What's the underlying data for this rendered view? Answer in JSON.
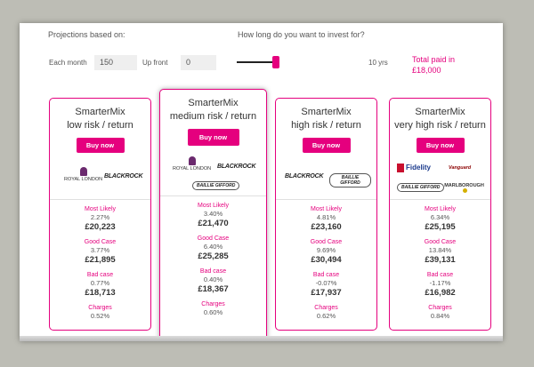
{
  "header": {
    "projections_label": "Projections based on:",
    "how_long_label": "How long do you want to invest for?",
    "each_month_label": "Each month",
    "each_month_value": "150",
    "up_front_label": "Up front",
    "up_front_value": "0",
    "duration_value": "10 yrs",
    "total_paid_line1": "Total paid in",
    "total_paid_line2": "£18,000"
  },
  "colors": {
    "accent": "#e5007e",
    "text": "#444444",
    "frame": "#bdbdb5"
  },
  "cards": [
    {
      "title_line1": "SmarterMix",
      "title_line2": "low risk / return",
      "button": "Buy now",
      "logos": [
        "ROYAL LONDON",
        "BLACKROCK"
      ],
      "most_likely_label": "Most Likely",
      "most_likely_pct": "2.27%",
      "most_likely_value": "£20,223",
      "good_case_label": "Good Case",
      "good_case_pct": "3.77%",
      "good_case_value": "£21,895",
      "bad_case_label": "Bad case",
      "bad_case_pct": "0.77%",
      "bad_case_value": "£18,713",
      "charges_label": "Charges",
      "charges_pct": "0.52%"
    },
    {
      "title_line1": "SmarterMix",
      "title_line2": "medium risk / return",
      "button": "Buy now",
      "logos": [
        "ROYAL LONDON",
        "BLACKROCK",
        "BAILLIE GIFFORD"
      ],
      "most_likely_label": "Most Likely",
      "most_likely_pct": "3.40%",
      "most_likely_value": "£21,470",
      "good_case_label": "Good Case",
      "good_case_pct": "6.40%",
      "good_case_value": "£25,285",
      "bad_case_label": "Bad case",
      "bad_case_pct": "0.40%",
      "bad_case_value": "£18,367",
      "charges_label": "Charges",
      "charges_pct": "0.60%"
    },
    {
      "title_line1": "SmarterMix",
      "title_line2": "high risk / return",
      "button": "Buy now",
      "logos": [
        "BLACKROCK",
        "BAILLIE GIFFORD"
      ],
      "most_likely_label": "Most Likely",
      "most_likely_pct": "4.81%",
      "most_likely_value": "£23,160",
      "good_case_label": "Good Case",
      "good_case_pct": "9.69%",
      "good_case_value": "£30,494",
      "bad_case_label": "Bad case",
      "bad_case_pct": "-0.07%",
      "bad_case_value": "£17,937",
      "charges_label": "Charges",
      "charges_pct": "0.62%"
    },
    {
      "title_line1": "SmarterMix",
      "title_line2": "very high risk / return",
      "button": "Buy now",
      "logos": [
        "Fidelity",
        "Vanguard",
        "BAILLIE GIFFORD",
        "MARLBOROUGH"
      ],
      "most_likely_label": "Most Likely",
      "most_likely_pct": "6.34%",
      "most_likely_value": "£25,195",
      "good_case_label": "Good Case",
      "good_case_pct": "13.84%",
      "good_case_value": "£39,131",
      "bad_case_label": "Bad case",
      "bad_case_pct": "-1.17%",
      "bad_case_value": "£16,982",
      "charges_label": "Charges",
      "charges_pct": "0.84%"
    }
  ]
}
